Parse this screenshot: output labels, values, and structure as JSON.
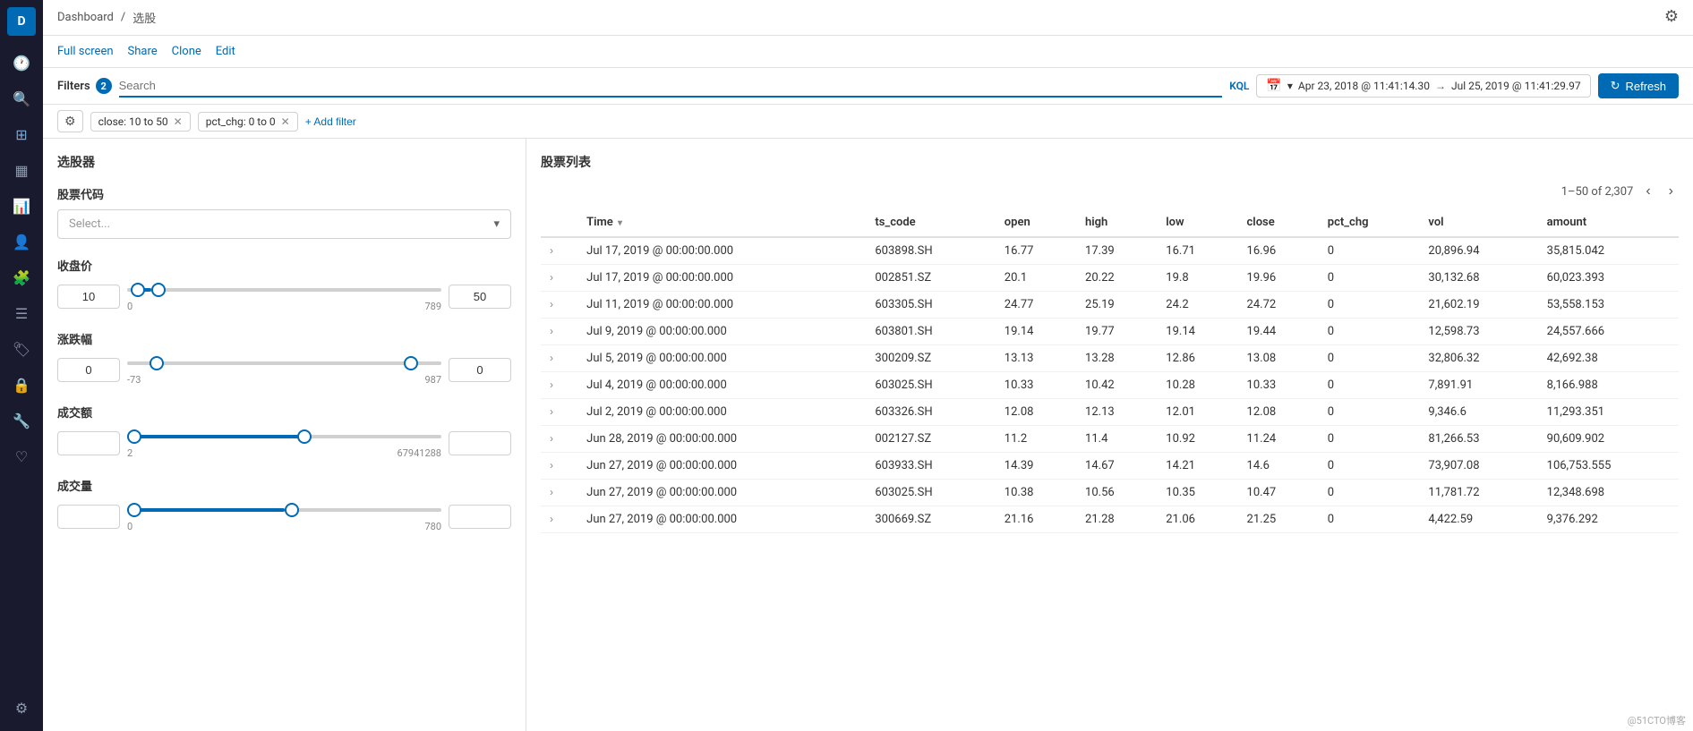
{
  "app": {
    "logo_letter": "D",
    "breadcrumb_home": "Dashboard",
    "breadcrumb_sep": "/",
    "breadcrumb_current": "选股"
  },
  "action_bar": {
    "full_screen": "Full screen",
    "share": "Share",
    "clone": "Clone",
    "edit": "Edit"
  },
  "filter_bar": {
    "filters_label": "Filters",
    "filters_count": "2",
    "search_placeholder": "Search",
    "kql_label": "KQL",
    "date_from": "Apr 23, 2018 @ 11:41:14.30",
    "date_to": "Jul 25, 2019 @ 11:41:29.97",
    "arrow": "→",
    "refresh_label": "Refresh"
  },
  "sub_filters": {
    "filter1": "close: 10 to 50",
    "filter2": "pct_chg: 0 to 0",
    "add_filter": "+ Add filter"
  },
  "left_panel": {
    "title": "选股器",
    "stock_code_label": "股票代码",
    "stock_code_placeholder": "Select...",
    "close_price_label": "收盘价",
    "close_min": "10",
    "close_max": "50",
    "close_slider_min": "0",
    "close_slider_max": "789",
    "pct_chg_label": "涨跌幅",
    "pct_chg_min": "0",
    "pct_chg_max": "0",
    "pct_chg_slider_min": "-73",
    "pct_chg_slider_max": "987",
    "amount_label": "成交额",
    "amount_min": "",
    "amount_max": "",
    "amount_slider_min": "2",
    "amount_slider_max": "67941288",
    "vol_label": "成交量",
    "vol_min": "",
    "vol_max": "",
    "vol_slider_min": "0",
    "vol_slider_max": "780"
  },
  "right_panel": {
    "title": "股票列表",
    "pagination": "1–50 of 2,307",
    "columns": [
      "",
      "Time",
      "ts_code",
      "open",
      "high",
      "low",
      "close",
      "pct_chg",
      "vol",
      "amount"
    ],
    "rows": [
      {
        "time": "Jul 17, 2019 @ 00:00:00.000",
        "ts_code": "603898.SH",
        "open": "16.77",
        "high": "17.39",
        "low": "16.71",
        "close": "16.96",
        "pct_chg": "0",
        "vol": "20,896.94",
        "amount": "35,815.042"
      },
      {
        "time": "Jul 17, 2019 @ 00:00:00.000",
        "ts_code": "002851.SZ",
        "open": "20.1",
        "high": "20.22",
        "low": "19.8",
        "close": "19.96",
        "pct_chg": "0",
        "vol": "30,132.68",
        "amount": "60,023.393"
      },
      {
        "time": "Jul 11, 2019 @ 00:00:00.000",
        "ts_code": "603305.SH",
        "open": "24.77",
        "high": "25.19",
        "low": "24.2",
        "close": "24.72",
        "pct_chg": "0",
        "vol": "21,602.19",
        "amount": "53,558.153"
      },
      {
        "time": "Jul 9, 2019 @ 00:00:00.000",
        "ts_code": "603801.SH",
        "open": "19.14",
        "high": "19.77",
        "low": "19.14",
        "close": "19.44",
        "pct_chg": "0",
        "vol": "12,598.73",
        "amount": "24,557.666"
      },
      {
        "time": "Jul 5, 2019 @ 00:00:00.000",
        "ts_code": "300209.SZ",
        "open": "13.13",
        "high": "13.28",
        "low": "12.86",
        "close": "13.08",
        "pct_chg": "0",
        "vol": "32,806.32",
        "amount": "42,692.38"
      },
      {
        "time": "Jul 4, 2019 @ 00:00:00.000",
        "ts_code": "603025.SH",
        "open": "10.33",
        "high": "10.42",
        "low": "10.28",
        "close": "10.33",
        "pct_chg": "0",
        "vol": "7,891.91",
        "amount": "8,166.988"
      },
      {
        "time": "Jul 2, 2019 @ 00:00:00.000",
        "ts_code": "603326.SH",
        "open": "12.08",
        "high": "12.13",
        "low": "12.01",
        "close": "12.08",
        "pct_chg": "0",
        "vol": "9,346.6",
        "amount": "11,293.351"
      },
      {
        "time": "Jun 28, 2019 @ 00:00:00.000",
        "ts_code": "002127.SZ",
        "open": "11.2",
        "high": "11.4",
        "low": "10.92",
        "close": "11.24",
        "pct_chg": "0",
        "vol": "81,266.53",
        "amount": "90,609.902"
      },
      {
        "time": "Jun 27, 2019 @ 00:00:00.000",
        "ts_code": "603933.SH",
        "open": "14.39",
        "high": "14.67",
        "low": "14.21",
        "close": "14.6",
        "pct_chg": "0",
        "vol": "73,907.08",
        "amount": "106,753.555"
      },
      {
        "time": "Jun 27, 2019 @ 00:00:00.000",
        "ts_code": "603025.SH",
        "open": "10.38",
        "high": "10.56",
        "low": "10.35",
        "close": "10.47",
        "pct_chg": "0",
        "vol": "11,781.72",
        "amount": "12,348.698"
      },
      {
        "time": "Jun 27, 2019 @ 00:00:00.000",
        "ts_code": "300669.SZ",
        "open": "21.16",
        "high": "21.28",
        "low": "21.06",
        "close": "21.25",
        "pct_chg": "0",
        "vol": "4,422.59",
        "amount": "9,376.292"
      }
    ]
  },
  "watermark": "@51CTO博客"
}
